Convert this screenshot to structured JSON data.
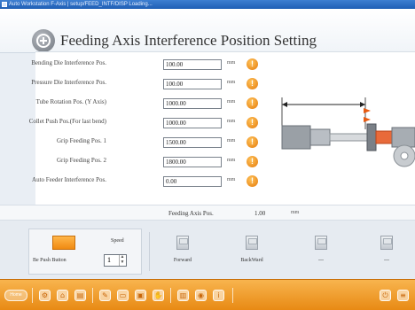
{
  "window": {
    "title": "Auto Workstation   F-Axis   |   setup/FEED_INTF/DISP   Loading..."
  },
  "page": {
    "title": "Feeding Axis Interference Position Setting"
  },
  "fields": [
    {
      "label": "Bending Die Interference Pos.",
      "value": "100.00",
      "unit": "mm"
    },
    {
      "label": "Pressure Die Interference Pos.",
      "value": "100.00",
      "unit": "mm"
    },
    {
      "label": "Tube Rotation Pos. (Y Axis)",
      "value": "1000.00",
      "unit": "mm"
    },
    {
      "label": "Collet Push Pos.(For last bend)",
      "value": "1000.00",
      "unit": "mm"
    },
    {
      "label": "Grip Feeding Pos. 1",
      "value": "1500.00",
      "unit": "mm"
    },
    {
      "label": "Grip Feeding Pos. 2",
      "value": "1800.00",
      "unit": "mm"
    },
    {
      "label": "Auto Feeder Interference Pos.",
      "value": "0.00",
      "unit": "mm"
    }
  ],
  "feeding_axis": {
    "label": "Feeding Axis Pos.",
    "value": "1.00",
    "unit": "mm"
  },
  "jog": {
    "push_label": "Be Push Button",
    "speed_label": "Speed",
    "speed_value": "1"
  },
  "function_buttons": [
    {
      "label": "Forward"
    },
    {
      "label": "BackWard"
    },
    {
      "label": "---"
    },
    {
      "label": "---"
    }
  ],
  "taskbar": {
    "home_label": "Home"
  },
  "colors": {
    "accent_orange": "#f29a1f",
    "warning": "#e8820c",
    "title_blue": "#2a6cc4"
  }
}
